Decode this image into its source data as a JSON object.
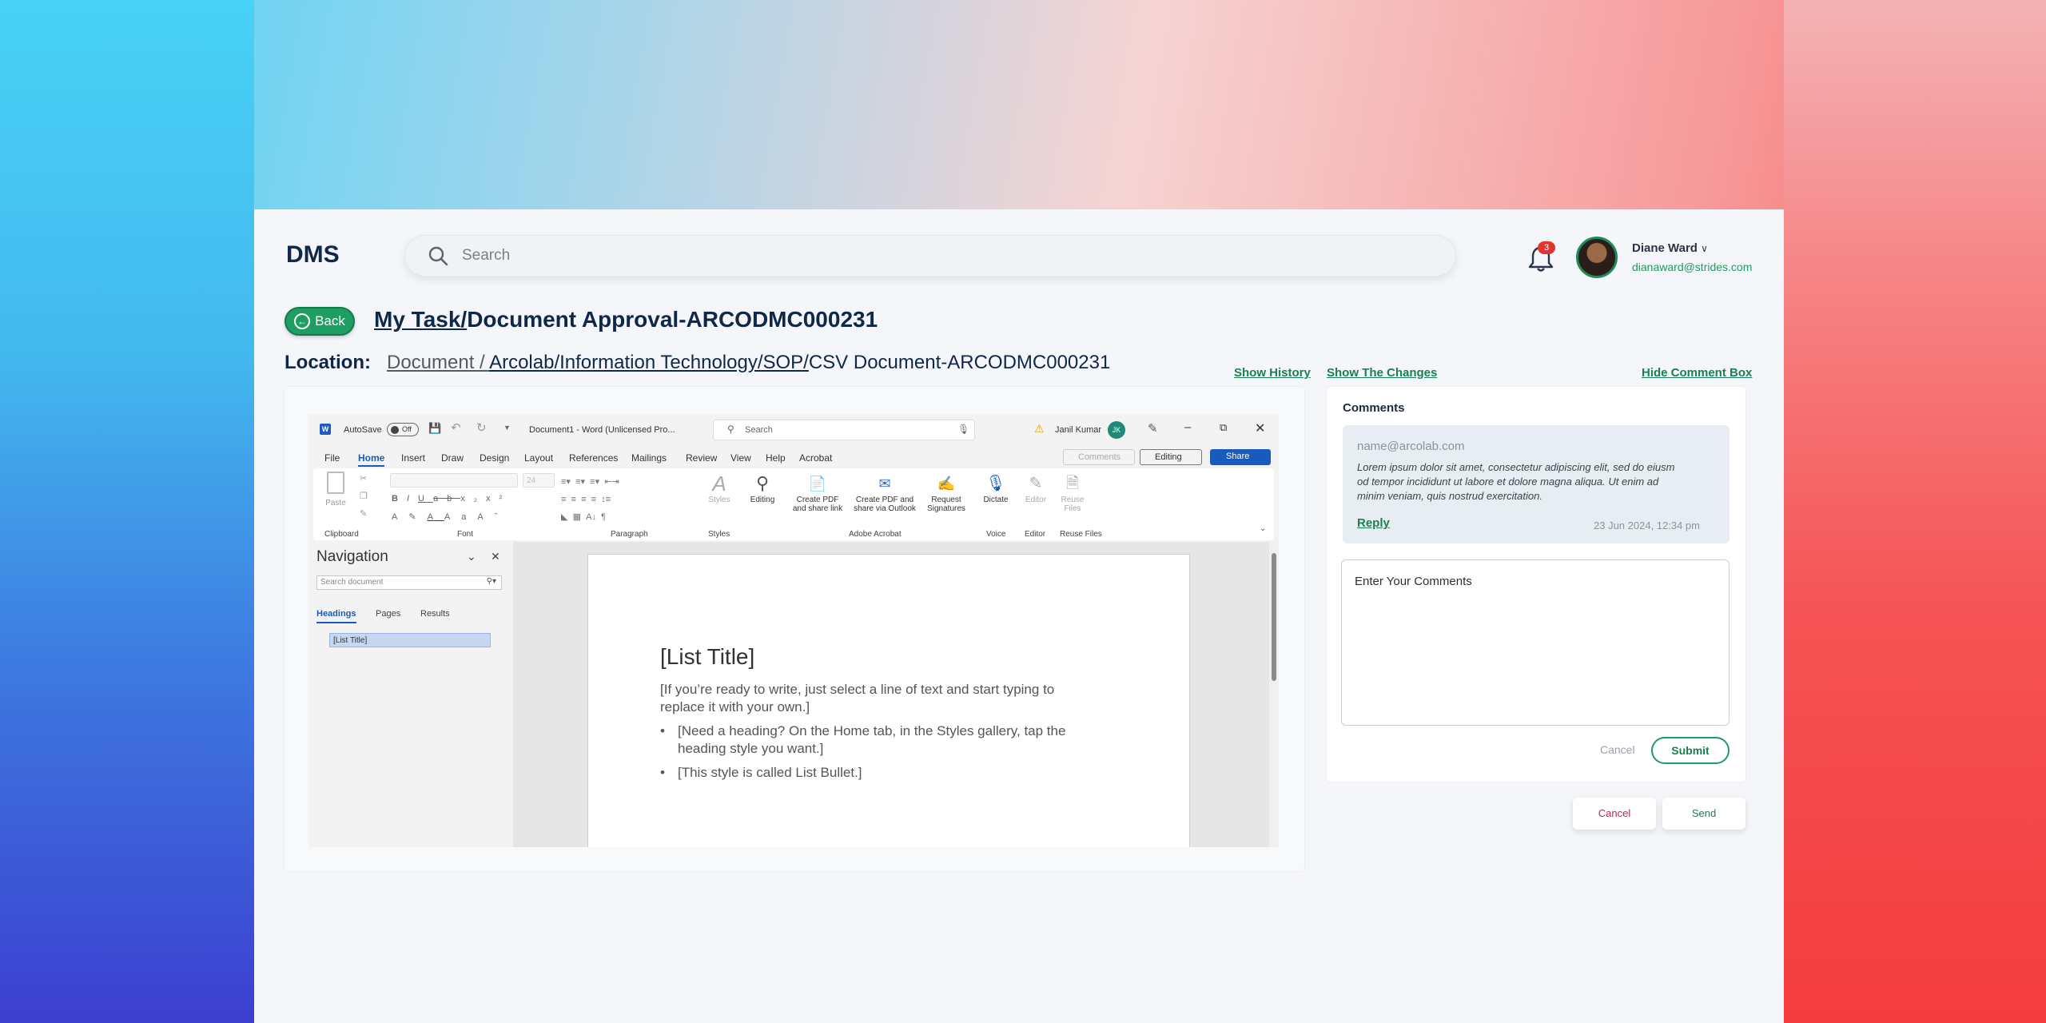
{
  "app": {
    "logo": "DMS"
  },
  "search": {
    "placeholder": "Search",
    "icon": "search-icon"
  },
  "user": {
    "name": "Diane Ward",
    "email": "dianaward@strides.com",
    "notifications": "3"
  },
  "page": {
    "back_label": "Back",
    "title_prefix": "My Task/",
    "title_rest": "Document Approval-ARCODMC000231",
    "location_label": "Location:",
    "location_doc": "Document / ",
    "location_path": "Arcolab/Information Technology/SOP/",
    "location_file": "CSV Document-ARCODMC000231"
  },
  "links": {
    "history": "Show History",
    "changes": "Show The Changes",
    "hide": "Hide Comment Box"
  },
  "word": {
    "autosave": "AutoSave",
    "toggle": "Off",
    "doc_title": "Document1  -  Word (Unlicensed Pro...",
    "search": "Search",
    "user": "Janil Kumar",
    "user_initials": "JK",
    "menu": [
      "File",
      "Home",
      "Insert",
      "Draw",
      "Design",
      "Layout",
      "References",
      "Mailings",
      "Review",
      "View",
      "Help",
      "Acrobat"
    ],
    "comments_btn": "Comments",
    "editing_btn": "Editing",
    "share_btn": "Share",
    "ribbon": {
      "paste": "Paste",
      "font_size": "24",
      "styles": "Styles",
      "editing": "Editing",
      "create_pdf": [
        "Create PDF",
        "and share link"
      ],
      "create_pdf_outlook": [
        "Create PDF and",
        "share via Outlook"
      ],
      "request_sig": [
        "Request",
        "Signatures"
      ],
      "dictate": "Dictate",
      "editor": "Editor",
      "reuse": [
        "Reuse",
        "Files"
      ],
      "groups": {
        "clipboard": "Clipboard",
        "font": "Font",
        "paragraph": "Paragraph",
        "styles": "Styles",
        "acrobat": "Adobe Acrobat",
        "voice": "Voice",
        "editor": "Editor",
        "reuse": "Reuse Files"
      }
    },
    "nav": {
      "title": "Navigation",
      "search_placeholder": "Search document",
      "tabs": [
        "Headings",
        "Pages",
        "Results"
      ],
      "item": "[List Title]"
    },
    "doc": {
      "heading": "[List Title]",
      "para": [
        "[If you’re ready to write, just select a line of text and start typing to",
        "replace it with your own.]"
      ],
      "bullets": [
        [
          "[Need a heading? On the Home tab, in the Styles gallery, tap the",
          "heading style you want.]"
        ],
        [
          "[This style is called List Bullet.]"
        ]
      ]
    }
  },
  "comments": {
    "title": "Comments",
    "author": "name@arcolab.com",
    "text": [
      "Lorem ipsum dolor sit amet, consectetur adipiscing elit, sed do eiusm",
      "od tempor incididunt ut labore et dolore magna aliqua. Ut enim ad",
      "minim veniam, quis nostrud exercitation."
    ],
    "reply": "Reply",
    "date": "23 Jun 2024, 12:34 pm",
    "input_placeholder": "Enter Your Comments",
    "cancel": "Cancel",
    "submit": "Submit"
  },
  "footer": {
    "cancel": "Cancel",
    "send": "Send"
  },
  "colors": {
    "primary": "#1e9e62",
    "navy": "#0f2748",
    "badge": "#e3342f",
    "word_blue": "#0f5fc6",
    "cancel_text": "#c0274d"
  }
}
